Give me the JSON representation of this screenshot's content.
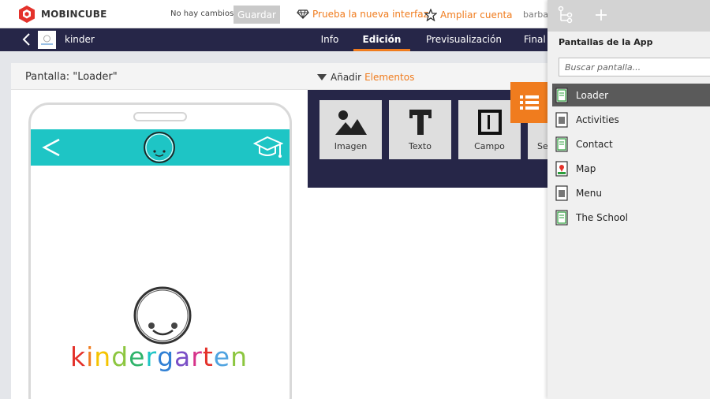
{
  "topbar": {
    "brand": "MOBINCUBE",
    "status": "No hay cambios",
    "save_label": "Guardar",
    "try_interface": "Prueba la nueva interfaz",
    "expand_account": "Ampliar cuenta",
    "user": "barbar"
  },
  "nav": {
    "app_name": "kinder",
    "tabs": [
      {
        "label": "Info"
      },
      {
        "label": "Edición"
      },
      {
        "label": "Previsualización"
      },
      {
        "label": "Final"
      }
    ],
    "active_tab": "Edición"
  },
  "editor": {
    "screen_label": "Pantalla: \"Loader\"",
    "add_label": "Añadir",
    "add_highlight": "Elementos"
  },
  "palette": {
    "tools": [
      {
        "label": "Imagen",
        "icon": "image-icon"
      },
      {
        "label": "Texto",
        "icon": "text-icon"
      },
      {
        "label": "Campo",
        "icon": "field-icon"
      },
      {
        "label": "Se",
        "icon": "partial-icon"
      }
    ]
  },
  "preview": {
    "logo_text": "kindergarten",
    "logo_colors": [
      "#e4322b",
      "#f07c1e",
      "#f5c400",
      "#8cc63f",
      "#2fb36a",
      "#1ec5c5",
      "#2f7fd4",
      "#7a4fc6",
      "#d6338a",
      "#e4322b",
      "#4fa3e0",
      "#8cc63f"
    ],
    "header_color": "#1ec5c5"
  },
  "panel": {
    "title": "Pantallas de la App",
    "search_placeholder": "Buscar pantalla...",
    "screens": [
      {
        "label": "Loader",
        "selected": true
      },
      {
        "label": "Activities",
        "selected": false
      },
      {
        "label": "Contact",
        "selected": false
      },
      {
        "label": "Map",
        "selected": false
      },
      {
        "label": "Menu",
        "selected": false
      },
      {
        "label": "The School",
        "selected": false
      }
    ]
  },
  "colors": {
    "accent": "#f07c1e",
    "navbar": "#262648",
    "panel_selected": "#5a5a5a"
  }
}
